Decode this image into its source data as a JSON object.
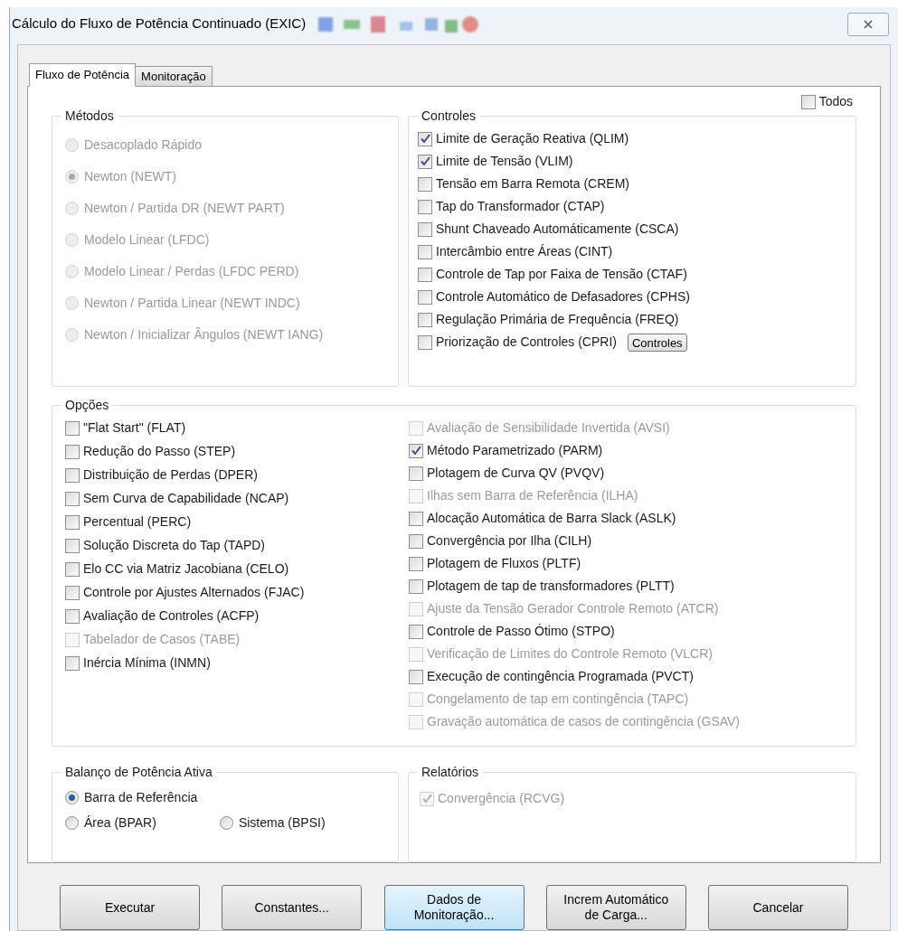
{
  "window": {
    "title": "Cálculo do Fluxo de Potência Continuado (EXIC)"
  },
  "tabs": [
    {
      "label": "Fluxo de Potência",
      "selected": true
    },
    {
      "label": "Monitoração",
      "selected": false
    }
  ],
  "todos": {
    "label": "Todos",
    "checked": false,
    "disabled": false
  },
  "metodos": {
    "title": "Métodos",
    "options": [
      {
        "label": "Desacoplado Rápido",
        "selected": false,
        "disabled": true
      },
      {
        "label": "Newton (NEWT)",
        "selected": true,
        "disabled": true
      },
      {
        "label": "Newton / Partida DR (NEWT PART)",
        "selected": false,
        "disabled": true
      },
      {
        "label": "Modelo Linear (LFDC)",
        "selected": false,
        "disabled": true
      },
      {
        "label": "Modelo Linear / Perdas (LFDC PERD)",
        "selected": false,
        "disabled": true
      },
      {
        "label": "Newton / Partida Linear (NEWT INDC)",
        "selected": false,
        "disabled": true
      },
      {
        "label": "Newton / Inicializar Ângulos (NEWT IANG)",
        "selected": false,
        "disabled": true
      }
    ]
  },
  "controles": {
    "title": "Controles",
    "button": "Controles",
    "items": [
      {
        "label": "Limite de Geração Reativa (QLIM)",
        "checked": true,
        "disabled": false
      },
      {
        "label": "Limite de Tensão (VLIM)",
        "checked": true,
        "disabled": false
      },
      {
        "label": "Tensão em Barra Remota (CREM)",
        "checked": false,
        "disabled": false
      },
      {
        "label": "Tap do Transformador (CTAP)",
        "checked": false,
        "disabled": false
      },
      {
        "label": "Shunt Chaveado Automáticamente (CSCA)",
        "checked": false,
        "disabled": false
      },
      {
        "label": "Intercâmbio entre Áreas (CINT)",
        "checked": false,
        "disabled": false
      },
      {
        "label": "Controle de Tap por Faixa de Tensão (CTAF)",
        "checked": false,
        "disabled": false
      },
      {
        "label": "Controle Automático de Defasadores (CPHS)",
        "checked": false,
        "disabled": false
      },
      {
        "label": "Regulação Primária de Frequência (FREQ)",
        "checked": false,
        "disabled": false
      },
      {
        "label": "Priorização de Controles (CPRI)",
        "checked": false,
        "disabled": false
      }
    ]
  },
  "opcoes": {
    "title": "Opções",
    "left": [
      {
        "label": "\"Flat Start\" (FLAT)",
        "checked": false,
        "disabled": false
      },
      {
        "label": "Redução do Passo (STEP)",
        "checked": false,
        "disabled": false
      },
      {
        "label": "Distribuição de Perdas (DPER)",
        "checked": false,
        "disabled": false
      },
      {
        "label": "Sem Curva de Capabilidade (NCAP)",
        "checked": false,
        "disabled": false
      },
      {
        "label": "Percentual (PERC)",
        "checked": false,
        "disabled": false
      },
      {
        "label": "Solução Discreta do Tap (TAPD)",
        "checked": false,
        "disabled": false
      },
      {
        "label": "Elo CC via Matriz Jacobiana (CELO)",
        "checked": false,
        "disabled": false
      },
      {
        "label": "Controle por Ajustes Alternados (FJAC)",
        "checked": false,
        "disabled": false
      },
      {
        "label": "Avaliação de Controles (ACFP)",
        "checked": false,
        "disabled": false
      },
      {
        "label": "Tabelador de Casos (TABE)",
        "checked": false,
        "disabled": true
      },
      {
        "label": "Inércia Mínima (INMN)",
        "checked": false,
        "disabled": false
      }
    ],
    "right": [
      {
        "label": "Avaliação de Sensibilidade Invertida (AVSI)",
        "checked": false,
        "disabled": true
      },
      {
        "label": "Método Parametrizado (PARM)",
        "checked": true,
        "disabled": false
      },
      {
        "label": "Plotagem de Curva QV (PVQV)",
        "checked": false,
        "disabled": false
      },
      {
        "label": "Ilhas sem Barra de Referência (ILHA)",
        "checked": false,
        "disabled": true
      },
      {
        "label": "Alocação Automática de Barra Slack (ASLK)",
        "checked": false,
        "disabled": false
      },
      {
        "label": "Convergência por Ilha (CILH)",
        "checked": false,
        "disabled": false
      },
      {
        "label": "Plotagem de Fluxos (PLTF)",
        "checked": false,
        "disabled": false
      },
      {
        "label": "Plotagem de tap de transformadores (PLTT)",
        "checked": false,
        "disabled": false
      },
      {
        "label": "Ajuste da Tensão Gerador Controle Remoto (ATCR)",
        "checked": false,
        "disabled": true
      },
      {
        "label": "Controle de Passo Ótimo (STPO)",
        "checked": false,
        "disabled": false
      },
      {
        "label": "Verificação de Limites do Controle Remoto (VLCR)",
        "checked": false,
        "disabled": true
      },
      {
        "label": "Execução de contingência Programada (PVCT)",
        "checked": false,
        "disabled": false
      },
      {
        "label": "Congelamento de tap em contingência (TAPC)",
        "checked": false,
        "disabled": true
      },
      {
        "label": "Gravação automática de casos de contingência (GSAV)",
        "checked": false,
        "disabled": true
      }
    ]
  },
  "balanco": {
    "title": "Balanço de Potência Ativa",
    "options": [
      {
        "label": "Barra de Referência",
        "selected": true,
        "disabled": false
      },
      {
        "label": "Área (BPAR)",
        "selected": false,
        "disabled": false
      },
      {
        "label": "Sistema (BPSI)",
        "selected": false,
        "disabled": false
      }
    ]
  },
  "relatorios": {
    "title": "Relatórios",
    "items": [
      {
        "label": "Convergência (RCVG)",
        "checked": true,
        "disabled": true
      }
    ]
  },
  "buttons": [
    {
      "label": "Executar",
      "focused": false
    },
    {
      "label": "Constantes...",
      "focused": false
    },
    {
      "label": "Dados de\nMonitoração...",
      "focused": true
    },
    {
      "label": "Increm Automático\nde Carga...",
      "focused": false
    },
    {
      "label": "Cancelar",
      "focused": false
    }
  ]
}
